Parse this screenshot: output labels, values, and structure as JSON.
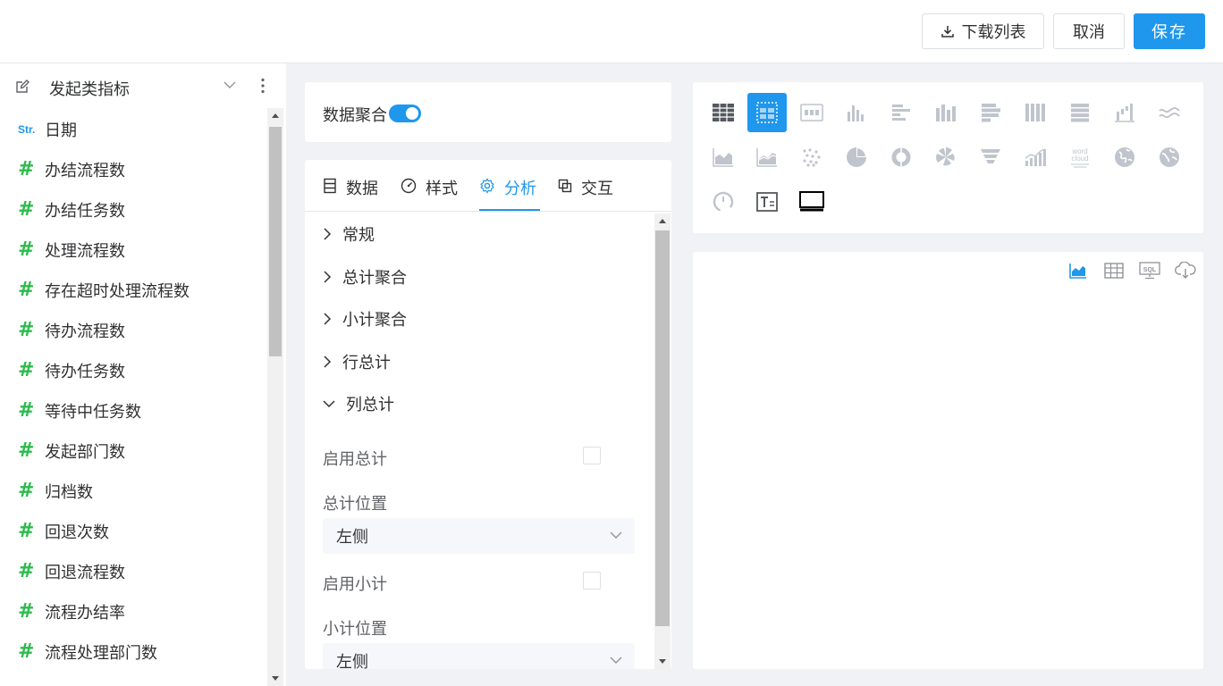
{
  "toolbar": {
    "download_label": "下载列表",
    "cancel_label": "取消",
    "save_label": "保存"
  },
  "sidebar": {
    "title": "发起类指标",
    "fields": [
      {
        "type": "Str.",
        "label": "日期"
      },
      {
        "type": "#",
        "label": "办结流程数"
      },
      {
        "type": "#",
        "label": "办结任务数"
      },
      {
        "type": "#",
        "label": "处理流程数"
      },
      {
        "type": "#",
        "label": "存在超时处理流程数"
      },
      {
        "type": "#",
        "label": "待办流程数"
      },
      {
        "type": "#",
        "label": "待办任务数"
      },
      {
        "type": "#",
        "label": "等待中任务数"
      },
      {
        "type": "#",
        "label": "发起部门数"
      },
      {
        "type": "#",
        "label": "归档数"
      },
      {
        "type": "#",
        "label": "回退次数"
      },
      {
        "type": "#",
        "label": "回退流程数"
      },
      {
        "type": "#",
        "label": "流程办结率"
      },
      {
        "type": "#",
        "label": "流程处理部门数"
      }
    ]
  },
  "aggregation": {
    "label": "数据聚合",
    "enabled": true
  },
  "tabs": [
    {
      "label": "数据",
      "icon": "data-icon"
    },
    {
      "label": "样式",
      "icon": "style-gauge-icon"
    },
    {
      "label": "分析",
      "icon": "gear-icon",
      "active": true
    },
    {
      "label": "交互",
      "icon": "interaction-icon"
    }
  ],
  "sections": [
    {
      "label": "常规",
      "expanded": false
    },
    {
      "label": "总计聚合",
      "expanded": false
    },
    {
      "label": "小计聚合",
      "expanded": false
    },
    {
      "label": "行总计",
      "expanded": false
    },
    {
      "label": "列总计",
      "expanded": true
    }
  ],
  "column_total": {
    "enable_total_label": "启用总计",
    "total_position_label": "总计位置",
    "total_position_value": "左侧",
    "enable_subtotal_label": "启用小计",
    "subtotal_position_label": "小计位置",
    "subtotal_position_value": "左侧"
  },
  "colors": {
    "accent": "#1e97ec",
    "number_field": "#2dbb4d",
    "icon_gray": "#c0c4cc"
  },
  "chart_types": [
    "table-icon",
    "pivot-table-icon",
    "kpi-card-icon",
    "bar-chart-icon",
    "horizontal-bar-icon",
    "grouped-bar-icon",
    "stacked-horizontal-bar-icon",
    "stacked-column-icon",
    "horizontal-stack-icon",
    "waterfall-icon",
    "wave-line-icon",
    "area-chart-icon",
    "line-chart-icon",
    "scatter-icon",
    "pie-chart-icon",
    "donut-chart-icon",
    "rose-chart-icon",
    "funnel-icon",
    "combo-chart-icon",
    "word-cloud-icon",
    "globe-icon",
    "world-map-icon",
    "gauge-icon",
    "text-icon",
    "monitor-icon"
  ],
  "word_cloud_text": [
    "word",
    "cloud"
  ],
  "preview_tools": [
    "area-chart-view-icon",
    "table-view-icon",
    "sql-view-icon",
    "cloud-download-icon"
  ],
  "sql_label": "SQL"
}
